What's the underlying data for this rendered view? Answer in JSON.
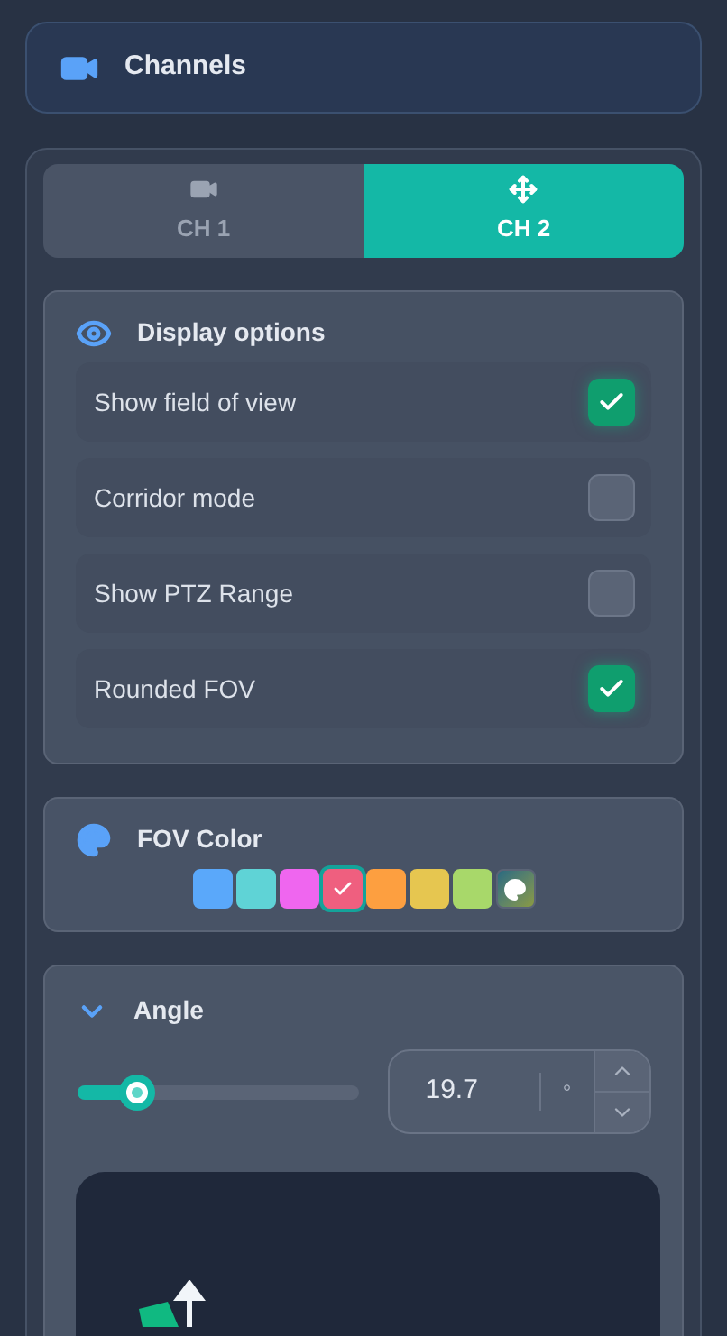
{
  "header": {
    "title": "Channels"
  },
  "tabs": [
    {
      "label": "CH 1",
      "kind": "camera",
      "selected": false
    },
    {
      "label": "CH 2",
      "kind": "move",
      "selected": true
    }
  ],
  "display_options": {
    "title": "Display options",
    "options": [
      {
        "label": "Show field of view",
        "checked": true
      },
      {
        "label": "Corridor mode",
        "checked": false
      },
      {
        "label": "Show PTZ Range",
        "checked": false
      },
      {
        "label": "Rounded FOV",
        "checked": true
      }
    ]
  },
  "fov_color": {
    "title": "FOV Color",
    "swatches": [
      {
        "kind": "swatch",
        "color": "#5aa8fa",
        "selected": false
      },
      {
        "kind": "swatch",
        "color": "#5fd3d6",
        "selected": false
      },
      {
        "kind": "swatch",
        "color": "#ef66ef",
        "selected": false
      },
      {
        "kind": "swatch",
        "color": "#ef5f7f",
        "selected": true
      },
      {
        "kind": "swatch",
        "color": "#fd9f40",
        "selected": false
      },
      {
        "kind": "swatch",
        "color": "#e6c650",
        "selected": false
      },
      {
        "kind": "swatch",
        "color": "#a8d86a",
        "selected": false
      },
      {
        "kind": "custom",
        "selected": false
      }
    ]
  },
  "angle": {
    "title": "Angle",
    "expanded": true,
    "level": 0.21,
    "value": "19.7",
    "unit": "°"
  }
}
